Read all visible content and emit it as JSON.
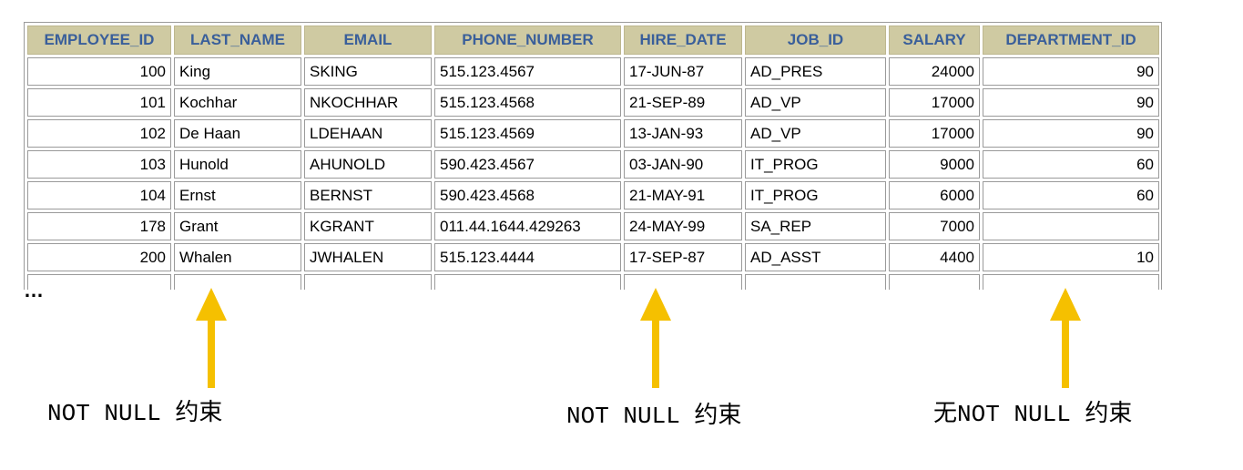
{
  "table": {
    "headers": [
      "EMPLOYEE_ID",
      "LAST_NAME",
      "EMAIL",
      "PHONE_NUMBER",
      "HIRE_DATE",
      "JOB_ID",
      "SALARY",
      "DEPARTMENT_ID"
    ],
    "rows": [
      [
        "100",
        "King",
        "SKING",
        "515.123.4567",
        "17-JUN-87",
        "AD_PRES",
        "24000",
        "90"
      ],
      [
        "101",
        "Kochhar",
        "NKOCHHAR",
        "515.123.4568",
        "21-SEP-89",
        "AD_VP",
        "17000",
        "90"
      ],
      [
        "102",
        "De Haan",
        "LDEHAAN",
        "515.123.4569",
        "13-JAN-93",
        "AD_VP",
        "17000",
        "90"
      ],
      [
        "103",
        "Hunold",
        "AHUNOLD",
        "590.423.4567",
        "03-JAN-90",
        "IT_PROG",
        "9000",
        "60"
      ],
      [
        "104",
        "Ernst",
        "BERNST",
        "590.423.4568",
        "21-MAY-91",
        "IT_PROG",
        "6000",
        "60"
      ],
      [
        "178",
        "Grant",
        "KGRANT",
        "011.44.1644.429263",
        "24-MAY-99",
        "SA_REP",
        "7000",
        ""
      ],
      [
        "200",
        "Whalen",
        "JWHALEN",
        "515.123.4444",
        "17-SEP-87",
        "AD_ASST",
        "4400",
        "10"
      ]
    ]
  },
  "ellipsis": "…",
  "annotations": {
    "last_name_note": "NOT NULL 约束",
    "hire_date_note": "NOT NULL 约束",
    "department_note": "无NOT NULL 约束"
  },
  "colors": {
    "header_bg": "#cfcaa2",
    "header_text": "#3a5f9a",
    "arrow": "#f5c000"
  }
}
